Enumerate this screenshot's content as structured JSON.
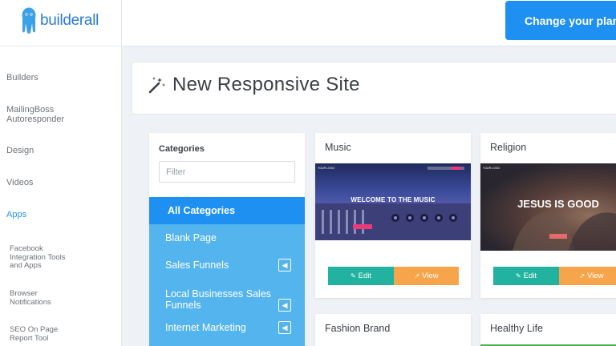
{
  "brand": {
    "name": "builderall",
    "accent": "#1e90f2",
    "sidebar_active": "#2196f3",
    "category_bg": "#54b5ee"
  },
  "header": {
    "plan_button": "Change your plan"
  },
  "sidebar": {
    "items": [
      {
        "label": "Builders"
      },
      {
        "label": "MailingBoss Autoresponder"
      },
      {
        "label": "Design"
      },
      {
        "label": "Videos"
      },
      {
        "label": "Apps",
        "active": true
      }
    ],
    "subitems": [
      {
        "label": "Facebook Integration Tools and Apps"
      },
      {
        "label": "Browser Notifications"
      },
      {
        "label": "SEO On Page Report Tool"
      }
    ]
  },
  "page": {
    "title": "New Responsive Site",
    "title_icon": "magic-wand-icon"
  },
  "categories": {
    "heading": "Categories",
    "filter_placeholder": "Filter",
    "items": [
      {
        "label": "All Categories",
        "active": true
      },
      {
        "label": "Blank Page"
      },
      {
        "label": "Sales Funnels",
        "has_submenu": true
      },
      {
        "label": "Local Businesses Sales Funnels",
        "has_submenu": true
      },
      {
        "label": "Internet Marketing",
        "has_submenu": true
      }
    ]
  },
  "templates": [
    {
      "title": "Music",
      "edit_label": "Edit",
      "view_label": "View",
      "thumb_logo": "YOUR LOGO",
      "thumb_headline": "WELCOME TO THE MUSIC"
    },
    {
      "title": "Religion",
      "edit_label": "Edit",
      "view_label": "View",
      "thumb_logo": "YOUR LOGO",
      "thumb_headline": "JESUS IS GOOD"
    },
    {
      "title": "Fashion Brand"
    },
    {
      "title": "Healthy Life"
    }
  ],
  "colors": {
    "edit_button": "#21b2a0",
    "view_button": "#f7a54b",
    "healthy_accent": "#4caf50"
  }
}
